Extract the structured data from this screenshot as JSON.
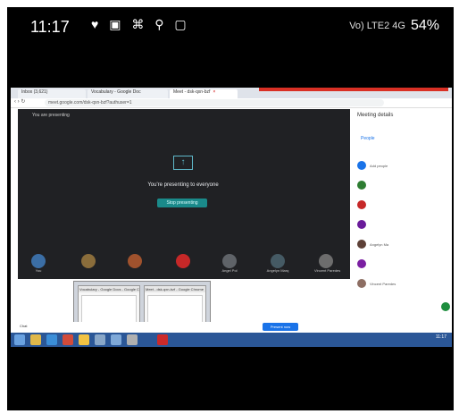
{
  "status_bar": {
    "time": "11:17",
    "left_icons": "♥ ▣ ⌘ ⚲ ▢",
    "signal": "Vo) LTE2 4G",
    "battery": "54%"
  },
  "browser": {
    "tabs": [
      {
        "label": "Inbox (3,621)"
      },
      {
        "label": "Vocabulary - Google Doc"
      },
      {
        "label": "Meet - dsk-qxn-bzf"
      }
    ],
    "url": "meet.google.com/dsk-qxn-bzf?authuser=1"
  },
  "meet": {
    "presenting_label": "You are presenting",
    "message": "You're presenting to everyone",
    "stop_button": "Stop presenting",
    "participants": [
      {
        "name": "You",
        "color": "#3b6ea5"
      },
      {
        "name": "",
        "color": "#8a6d3b"
      },
      {
        "name": "",
        "color": "#a0522d"
      },
      {
        "name": "",
        "color": "#c62828"
      },
      {
        "name": "Angel Pol",
        "color": "#5f6368"
      },
      {
        "name": "Angelyn Marq",
        "color": "#455a64"
      },
      {
        "name": "Vincent Paredes",
        "color": "#6d6d6d"
      }
    ]
  },
  "side_panel": {
    "title": "Meeting details",
    "people_tab": "People",
    "rows": [
      {
        "name": "Add people",
        "color": "#1a73e8"
      },
      {
        "name": "",
        "color": "#2e7d32"
      },
      {
        "name": "",
        "color": "#c62828"
      },
      {
        "name": "",
        "color": "#6a1b9a"
      },
      {
        "name": "Angelyn Ma",
        "color": "#5d4037"
      },
      {
        "name": "",
        "color": "#7b1fa2"
      },
      {
        "name": "Vincent Paredes",
        "color": "#8d6e63"
      }
    ]
  },
  "thumbnails": [
    {
      "caption": "Vocabulary - Google Docs - Google Chrome"
    },
    {
      "caption": "Meet - dsk-qxn-bzf - Google Chrome"
    }
  ],
  "bottom_bar": {
    "left": "Chat",
    "present_now": "Present now"
  },
  "taskbar": {
    "clock": "11:17"
  }
}
